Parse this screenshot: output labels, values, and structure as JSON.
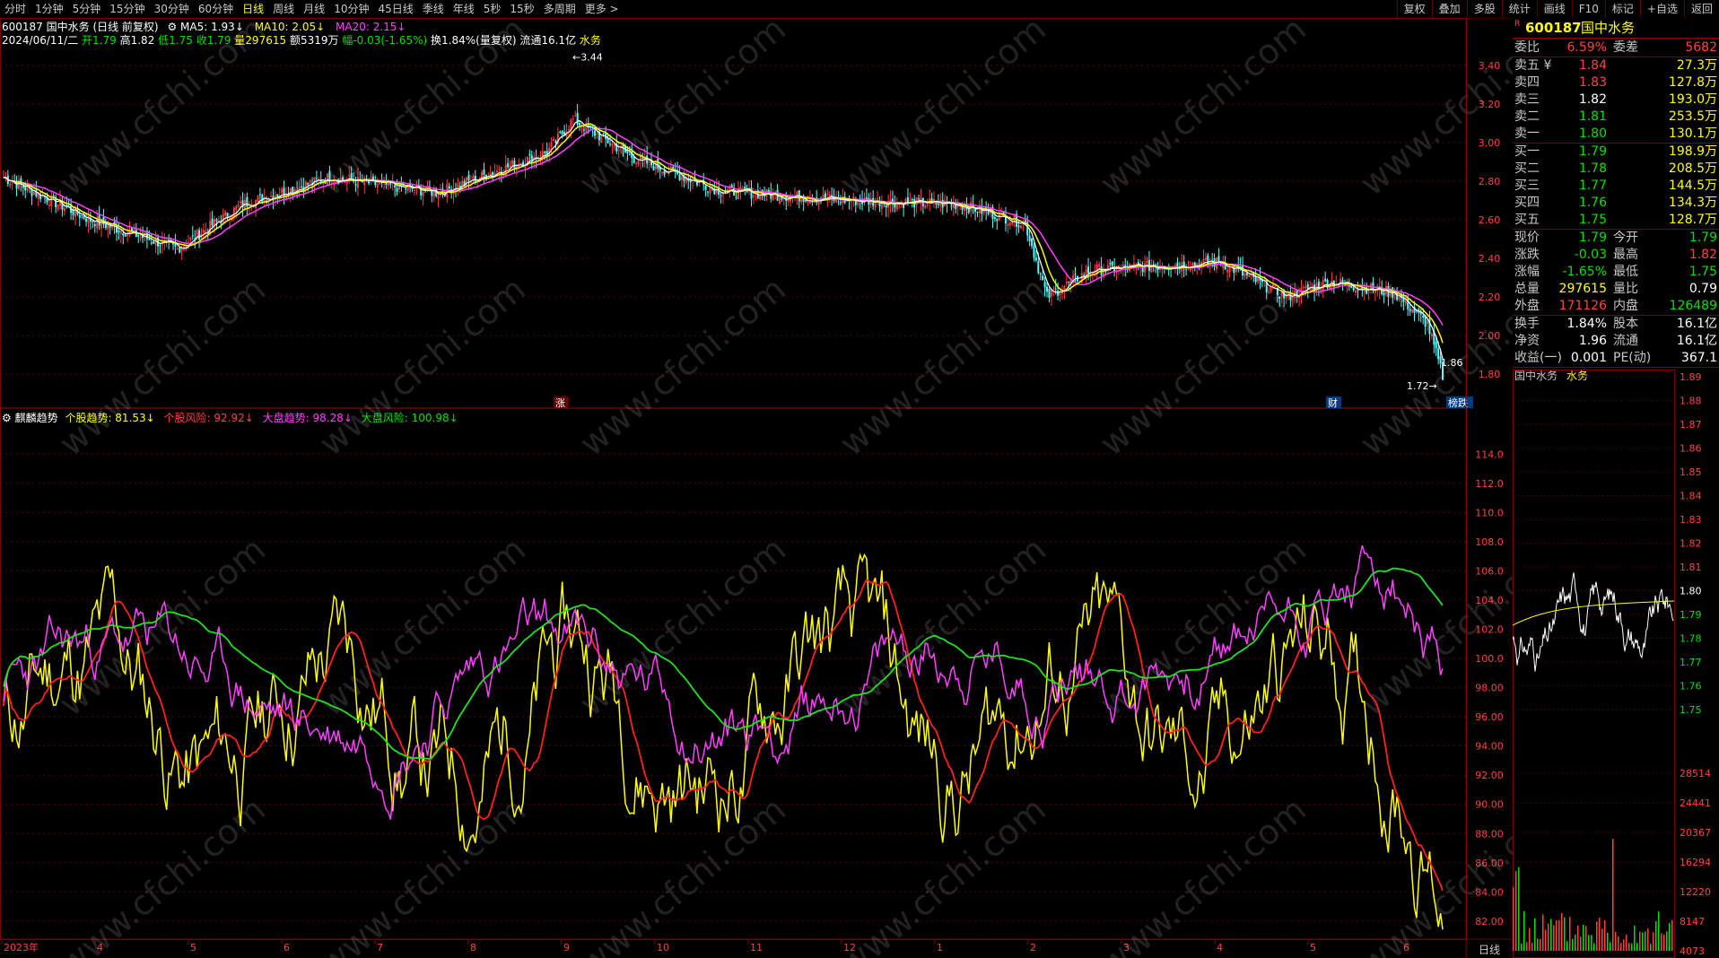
{
  "toolbar": {
    "periods": [
      "分时",
      "1分钟",
      "5分钟",
      "15分钟",
      "30分钟",
      "60分钟",
      "日线",
      "周线",
      "月线",
      "10分钟",
      "45日线",
      "季线",
      "年线",
      "5秒",
      "15秒",
      "多周期",
      "更多 >"
    ],
    "active_period": "日线",
    "right_buttons": [
      "复权",
      "叠加",
      "多股",
      "统计",
      "画线",
      "F10",
      "标记",
      "+自选",
      "返回"
    ]
  },
  "chart_header": {
    "code_name": "600187 国中水务 (日线 前复权)",
    "ma5": "MA5: 1.93↓",
    "ma10": "MA10: 2.05↓",
    "ma20": "MA20: 2.15↓",
    "date": "2024/06/11/二",
    "open": "开1.79",
    "high": "高1.82",
    "low": "低1.75",
    "close": "收1.79",
    "volume": "量297615",
    "amount": "额5319万",
    "change": "幅-0.03(-1.65%)",
    "turnover": "换1.84%(量复权)",
    "float": "流通16.1亿",
    "sector": "水务"
  },
  "price_axis": [
    "3.40",
    "3.20",
    "3.00",
    "2.80",
    "2.60",
    "2.40",
    "2.20",
    "2.00",
    "1.80"
  ],
  "price_marks": {
    "high": "3.44",
    "recent": "1.86",
    "low": "1.72"
  },
  "event_tags": [
    "涨",
    "财",
    "榜跌"
  ],
  "indicator_header": {
    "name": "麒麟趋势",
    "s1": "个股趋势: 81.53↓",
    "s2": "个股风险: 92.92↓",
    "s3": "大盘趋势: 98.28↓",
    "s4": "大盘风险: 100.98↓"
  },
  "indicator_axis": [
    "114.0",
    "112.0",
    "110.0",
    "108.0",
    "106.0",
    "104.0",
    "102.0",
    "100.0",
    "98.00",
    "96.00",
    "94.00",
    "92.00",
    "90.00",
    "88.00",
    "86.00",
    "84.00",
    "82.00"
  ],
  "date_axis": [
    "2023年",
    "4",
    "5",
    "6",
    "7",
    "8",
    "9",
    "10",
    "11",
    "12",
    "1",
    "2",
    "3",
    "4",
    "5",
    "6"
  ],
  "date_axis_label": "日线",
  "watermark": "www.cfchi.com",
  "quote": {
    "flag": "R",
    "code": "600187",
    "name": "国中水务",
    "weibi_label": "委比",
    "weibi": "6.59%",
    "weicha_label": "委差",
    "weicha": "5682",
    "asks": [
      {
        "label": "卖五",
        "flag": "¥",
        "price": "1.84",
        "vol": "27.3万"
      },
      {
        "label": "卖四",
        "price": "1.83",
        "vol": "127.8万"
      },
      {
        "label": "卖三",
        "price": "1.82",
        "vol": "193.0万"
      },
      {
        "label": "卖二",
        "price": "1.81",
        "vol": "253.5万"
      },
      {
        "label": "卖一",
        "price": "1.80",
        "vol": "130.1万"
      }
    ],
    "bids": [
      {
        "label": "买一",
        "price": "1.79",
        "vol": "198.9万"
      },
      {
        "label": "买二",
        "price": "1.78",
        "vol": "208.5万"
      },
      {
        "label": "买三",
        "price": "1.77",
        "vol": "144.5万"
      },
      {
        "label": "买四",
        "price": "1.76",
        "vol": "134.3万"
      },
      {
        "label": "买五",
        "price": "1.75",
        "vol": "128.7万"
      }
    ],
    "stats": [
      {
        "l1": "现价",
        "v1": "1.79",
        "l2": "今开",
        "v2": "1.79"
      },
      {
        "l1": "涨跌",
        "v1": "-0.03",
        "l2": "最高",
        "v2": "1.82"
      },
      {
        "l1": "涨幅",
        "v1": "-1.65%",
        "l2": "最低",
        "v2": "1.75"
      },
      {
        "l1": "总量",
        "v1": "297615",
        "l2": "量比",
        "v2": "0.79"
      },
      {
        "l1": "外盘",
        "v1": "171126",
        "l2": "内盘",
        "v2": "126489"
      }
    ],
    "stats2": [
      {
        "l1": "换手",
        "v1": "1.84%",
        "l2": "股本",
        "v2": "16.1亿"
      },
      {
        "l1": "净资",
        "v1": "1.96",
        "l2": "流通",
        "v2": "16.1亿"
      },
      {
        "l1": "收益(一)",
        "v1": "0.001",
        "l2": "PE(动)",
        "v2": "367.1"
      }
    ]
  },
  "mini": {
    "title": "国中水务",
    "sector": "水务",
    "price_axis": [
      "1.89",
      "1.88",
      "1.87",
      "1.86",
      "1.85",
      "1.84",
      "1.83",
      "1.82",
      "1.81",
      "1.80",
      "1.79",
      "1.78",
      "1.77",
      "1.76",
      "1.75"
    ],
    "volume_axis": [
      "28514",
      "24441",
      "20367",
      "16294",
      "12220",
      "8147",
      "4073"
    ]
  },
  "colors": {
    "up": "#ff3c3c",
    "down": "#54ffff",
    "ma5": "#ffffff",
    "ma10": "#ffff00",
    "ma20": "#ff40ff",
    "grid": "#7a0000"
  }
}
